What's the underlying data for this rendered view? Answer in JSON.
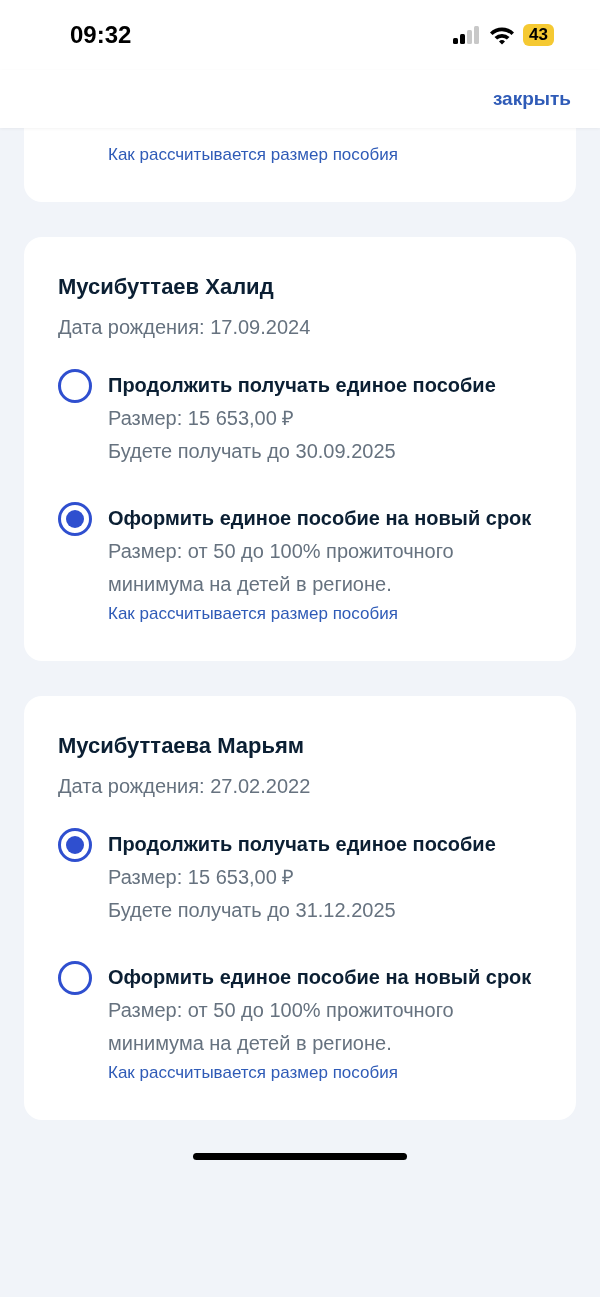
{
  "status_bar": {
    "time": "09:32",
    "battery": "43"
  },
  "header": {
    "close": "закрыть"
  },
  "top_card": {
    "link": "Как рассчитывается размер пособия"
  },
  "children": [
    {
      "name": "Мусибуттаев Халид",
      "birth_date": "Дата рождения: 17.09.2024",
      "options": [
        {
          "title": "Продолжить получать единое пособие",
          "selected": false,
          "lines": [
            "Размер: 15 653,00 ₽",
            "Будете получать до 30.09.2025"
          ]
        },
        {
          "title": "Оформить единое пособие на новый срок",
          "selected": true,
          "lines": [
            "Размер: от 50 до 100% прожиточного минимума на детей в регионе."
          ],
          "link": "Как рассчитывается размер пособия"
        }
      ]
    },
    {
      "name": "Мусибуттаева Марьям",
      "birth_date": "Дата рождения: 27.02.2022",
      "options": [
        {
          "title": "Продолжить получать единое пособие",
          "selected": true,
          "lines": [
            "Размер: 15 653,00 ₽",
            "Будете получать до 31.12.2025"
          ]
        },
        {
          "title": "Оформить единое пособие на новый срок",
          "selected": false,
          "lines": [
            "Размер: от 50 до 100% прожиточного минимума на детей в регионе."
          ],
          "link": "Как рассчитывается размер пособия"
        }
      ]
    }
  ]
}
